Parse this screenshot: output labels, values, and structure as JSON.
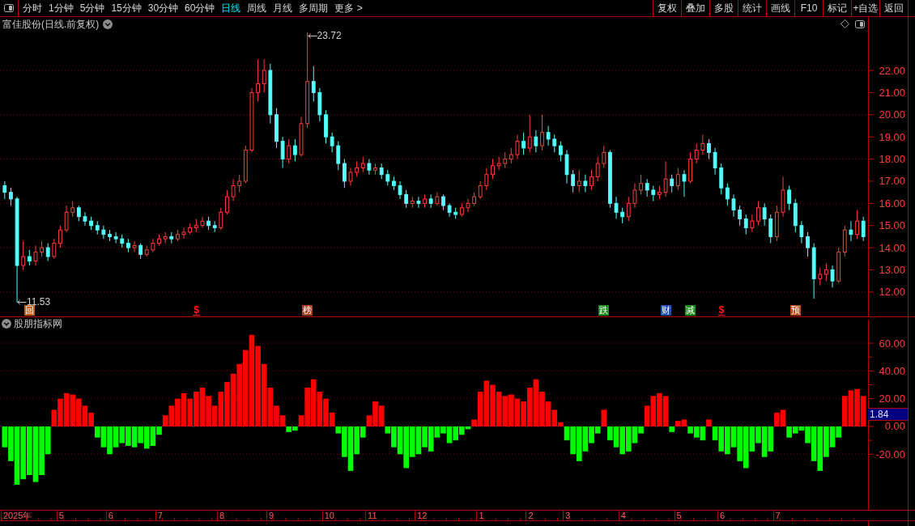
{
  "toolbar": {
    "periods": [
      {
        "label": "分时",
        "selected": false
      },
      {
        "label": "1分钟",
        "selected": false
      },
      {
        "label": "5分钟",
        "selected": false
      },
      {
        "label": "15分钟",
        "selected": false
      },
      {
        "label": "30分钟",
        "selected": false
      },
      {
        "label": "60分钟",
        "selected": false
      },
      {
        "label": "日线",
        "selected": true
      },
      {
        "label": "周线",
        "selected": false
      },
      {
        "label": "月线",
        "selected": false
      },
      {
        "label": "多周期",
        "selected": false
      },
      {
        "label": "更多 >",
        "selected": false
      }
    ],
    "actions": [
      "复权",
      "叠加",
      "多股",
      "统计",
      "画线",
      "F10",
      "标记",
      "+自选",
      "返回"
    ]
  },
  "price_panel": {
    "title": "富佳股份(日线.前复权)",
    "axis_labels": [
      "22.00",
      "21.00",
      "20.00",
      "19.00",
      "18.00",
      "17.00",
      "16.00",
      "15.00",
      "14.00",
      "13.00",
      "12.00"
    ],
    "high_label": "23.72",
    "low_label": "11.53",
    "event_markers": [
      {
        "kind": "tag",
        "text": "回",
        "color": "#c0601c"
      },
      {
        "kind": "symbol",
        "text": "$",
        "color": "#ff2020"
      },
      {
        "kind": "tag",
        "text": "榜",
        "color": "#a8401c"
      },
      {
        "kind": "tag",
        "text": "跌",
        "color": "#1e8c1e"
      },
      {
        "kind": "tag",
        "text": "财",
        "color": "#2050a8"
      },
      {
        "kind": "tag",
        "text": "减",
        "color": "#1e8c1e"
      },
      {
        "kind": "symbol",
        "text": "$",
        "color": "#ff2020"
      },
      {
        "kind": "tag",
        "text": "预",
        "color": "#b8481a"
      }
    ]
  },
  "indicator_panel": {
    "title": "股朋指标网",
    "value_label": "1.84",
    "chart_data": {
      "type": "bar",
      "ylim": [
        -60.06,
        76.95
      ],
      "yticks": [
        {
          "value": 60,
          "label": "60.00"
        },
        {
          "value": 40,
          "label": "40.00"
        },
        {
          "value": 20,
          "label": "20.00"
        },
        {
          "value": 0,
          "label": "0.00"
        },
        {
          "value": -20,
          "label": "-20.00"
        }
      ],
      "grid": true,
      "values": [
        -15,
        -25,
        -42,
        -38,
        -35,
        -40,
        -35,
        -20,
        12,
        20,
        24,
        23,
        20,
        15,
        10,
        -8,
        -15,
        -20,
        -15,
        -12,
        -14,
        -15,
        -12,
        -16,
        -14,
        -6,
        8,
        15,
        20,
        24,
        20,
        25,
        28,
        22,
        15,
        25,
        32,
        38,
        45,
        55,
        66,
        58,
        45,
        28,
        15,
        8,
        -4,
        -3,
        8,
        28,
        34,
        25,
        20,
        10,
        -5,
        -22,
        -32,
        -20,
        -8,
        8,
        18,
        15,
        -5,
        -15,
        -20,
        -30,
        -22,
        -20,
        -15,
        -18,
        -8,
        -5,
        -12,
        -10,
        -6,
        -2,
        5,
        25,
        33,
        30,
        25,
        22,
        23,
        20,
        18,
        28,
        34,
        25,
        18,
        12,
        3,
        -10,
        -20,
        -25,
        -18,
        -12,
        -5,
        12,
        -10,
        -15,
        -20,
        -18,
        -12,
        -5,
        15,
        22,
        24,
        22,
        -4,
        4,
        5,
        -5,
        -8,
        -10,
        5,
        -10,
        -18,
        -20,
        -15,
        -25,
        -30,
        -18,
        -12,
        -22,
        -18,
        10,
        12,
        -8,
        -5,
        -3,
        -12,
        -25,
        -32,
        -22,
        -15,
        -8,
        22,
        26,
        27,
        22
      ]
    }
  },
  "date_axis": [
    "2025年",
    "5",
    "6",
    "7",
    "8",
    "9",
    "10",
    "11",
    "12",
    "1",
    "2",
    "3",
    "4",
    "5",
    "6",
    "7"
  ]
}
